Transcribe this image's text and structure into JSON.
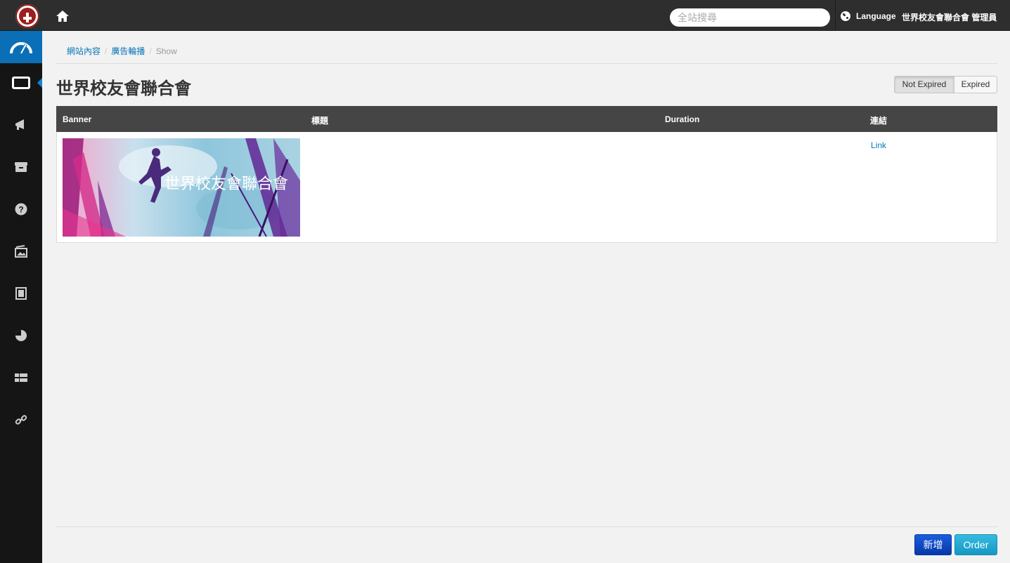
{
  "topbar": {
    "search_placeholder": "全站搜尋",
    "language_label": "Language",
    "user_label": "世界校友會聯合會 管理員"
  },
  "sidebar": {
    "items": [
      {
        "icon": "dashboard-icon"
      },
      {
        "icon": "monitor-icon",
        "active": true
      },
      {
        "icon": "megaphone-icon"
      },
      {
        "icon": "archive-icon"
      },
      {
        "icon": "help-icon"
      },
      {
        "icon": "gallery-icon"
      },
      {
        "icon": "page-icon"
      },
      {
        "icon": "pie-chart-icon"
      },
      {
        "icon": "grid-icon"
      },
      {
        "icon": "link-icon"
      }
    ]
  },
  "breadcrumb": {
    "items": [
      "網站內容",
      "廣告輪播",
      "Show"
    ]
  },
  "page": {
    "title": "世界校友會聯合會"
  },
  "filters": {
    "not_expired": "Not Expired",
    "expired": "Expired"
  },
  "table": {
    "columns": [
      "Banner",
      "標題",
      "Duration",
      "連結"
    ],
    "rows": [
      {
        "banner_text": "世界校友會聯合會",
        "title": "",
        "duration": "",
        "link": "Link"
      }
    ]
  },
  "actions": {
    "add": "新增",
    "order": "Order"
  },
  "colors": {
    "topbar": "#2e2e2e",
    "sidebar": "#151515",
    "accent": "#0b6fb7",
    "link": "#0a76b8",
    "add_button": "#0d47c8",
    "order_button": "#22aad4"
  }
}
